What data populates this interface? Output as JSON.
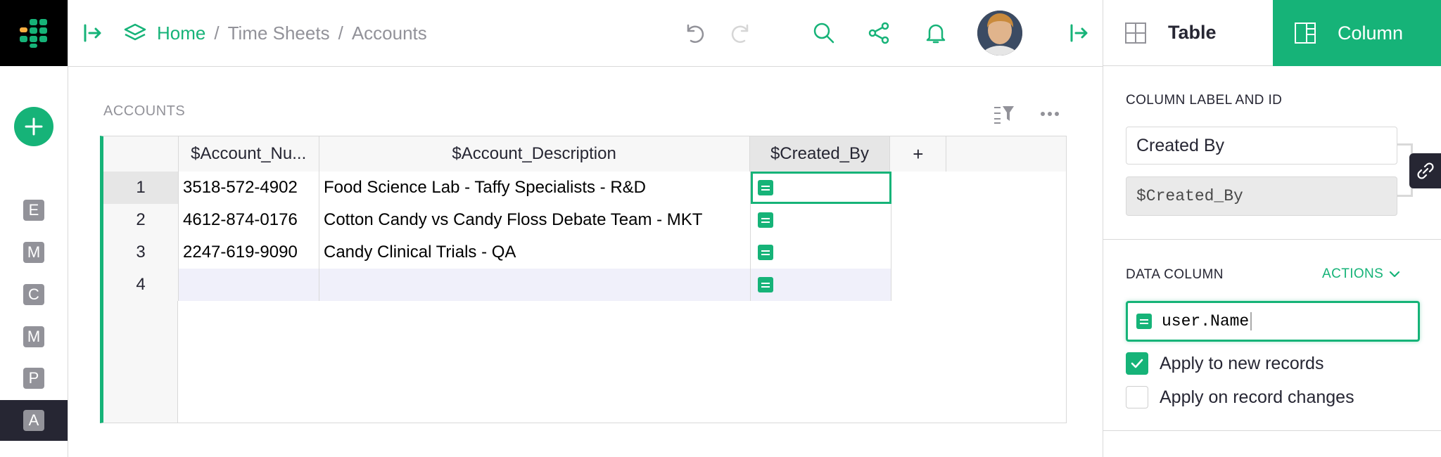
{
  "breadcrumb": {
    "home": "Home",
    "sep": "/",
    "doc": "Time Sheets",
    "page": "Accounts"
  },
  "rail": {
    "pages": [
      "E",
      "M",
      "C",
      "M",
      "P",
      "A"
    ]
  },
  "section": {
    "title": "ACCOUNTS"
  },
  "grid": {
    "columns": [
      "$Account_Nu...",
      "$Account_Description",
      "$Created_By",
      "+"
    ],
    "rows": [
      {
        "num": "1",
        "account_number": "3518-572-4902",
        "description": "Food Science Lab - Taffy Specialists - R&D"
      },
      {
        "num": "2",
        "account_number": "4612-874-0176",
        "description": "Cotton Candy vs Candy Floss Debate Team - MKT"
      },
      {
        "num": "3",
        "account_number": "2247-619-9090",
        "description": "Candy Clinical Trials - QA"
      },
      {
        "num": "4",
        "account_number": "",
        "description": ""
      }
    ]
  },
  "panel": {
    "tab_table": "Table",
    "tab_column": "Column",
    "label_heading": "COLUMN LABEL AND ID",
    "label_value": "Created By",
    "id_value": "$Created_By",
    "data_column_heading": "DATA COLUMN",
    "actions_label": "ACTIONS",
    "formula": "user.Name",
    "apply_new": "Apply to new records",
    "apply_changes": "Apply on record changes",
    "apply_new_checked": true,
    "apply_changes_checked": false
  },
  "colors": {
    "accent": "#16b378",
    "dark": "#262633",
    "muted": "#929299"
  }
}
